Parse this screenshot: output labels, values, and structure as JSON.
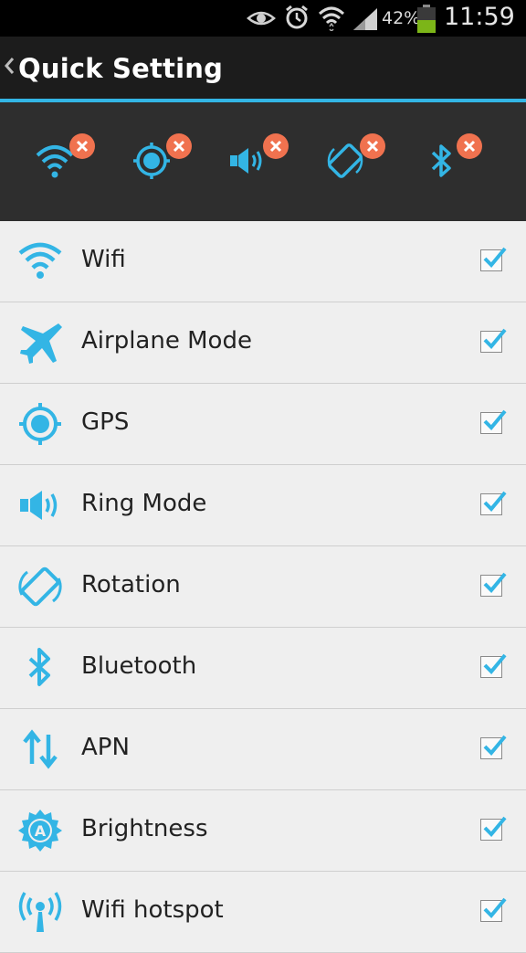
{
  "status_bar": {
    "icons": [
      "eye-icon",
      "alarm-clock-icon",
      "wifi-icon",
      "signal-icon",
      "battery-icon"
    ],
    "battery_percent": "42%",
    "time": "11:59"
  },
  "action_bar": {
    "back_icon": "chevron-left-icon",
    "title": "Quick Setting"
  },
  "quick_tiles": [
    {
      "name": "wifi",
      "icon": "wifi-icon"
    },
    {
      "name": "gps",
      "icon": "gps-icon"
    },
    {
      "name": "ring-mode",
      "icon": "speaker-icon"
    },
    {
      "name": "rotation",
      "icon": "rotation-icon"
    },
    {
      "name": "bluetooth",
      "icon": "bluetooth-icon"
    }
  ],
  "settings_list": [
    {
      "label": "Wifi",
      "icon": "wifi-icon",
      "checked": true
    },
    {
      "label": "Airplane Mode",
      "icon": "airplane-icon",
      "checked": true
    },
    {
      "label": "GPS",
      "icon": "gps-icon",
      "checked": true
    },
    {
      "label": "Ring Mode",
      "icon": "speaker-icon",
      "checked": true
    },
    {
      "label": "Rotation",
      "icon": "rotation-icon",
      "checked": true
    },
    {
      "label": "Bluetooth",
      "icon": "bluetooth-icon",
      "checked": true
    },
    {
      "label": "APN",
      "icon": "data-arrows-icon",
      "checked": true
    },
    {
      "label": "Brightness",
      "icon": "brightness-auto-icon",
      "checked": true
    },
    {
      "label": "Wifi hotspot",
      "icon": "hotspot-icon",
      "checked": true
    }
  ],
  "colors": {
    "accent": "#33b5e5",
    "remove_badge": "#f0724f",
    "panel_bg": "#2e2e2e",
    "list_bg": "#efefef"
  }
}
